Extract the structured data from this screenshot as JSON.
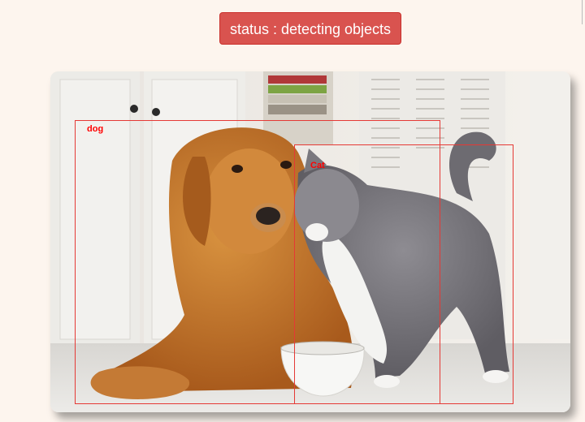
{
  "status": {
    "label": "status : detecting objects"
  },
  "detections": [
    {
      "label": "dog"
    },
    {
      "label": "Cat"
    }
  ],
  "colors": {
    "status_bg": "#d9534f",
    "box": "#e53935",
    "label": "#ff0000",
    "page_bg": "#fdf5ee"
  }
}
